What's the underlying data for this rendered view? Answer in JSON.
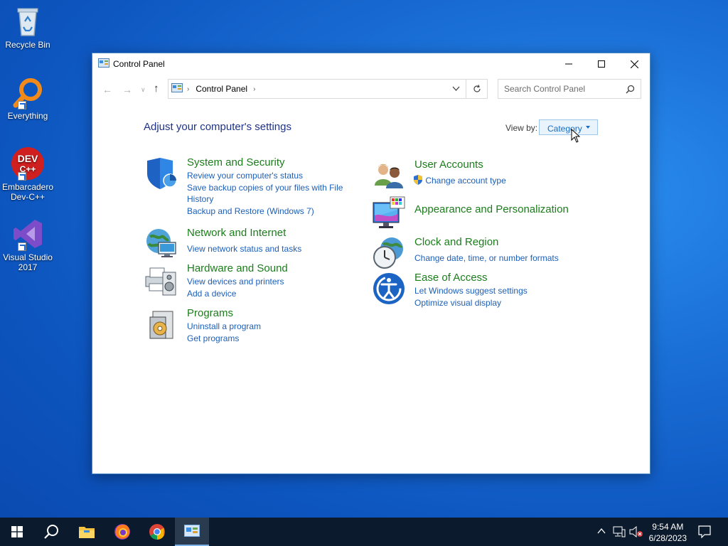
{
  "desktop": {
    "icons": [
      {
        "label": "Recycle Bin"
      },
      {
        "label": "Everything"
      },
      {
        "label": "Embarcadero Dev-C++",
        "badge": "DEV C++"
      },
      {
        "label": "Visual Studio 2017"
      }
    ]
  },
  "window": {
    "title": "Control Panel",
    "breadcrumb": "Control Panel",
    "search_placeholder": "Search Control Panel",
    "heading": "Adjust your computer's settings",
    "view_by_label": "View by:",
    "view_by_value": "Category"
  },
  "categories": {
    "system": {
      "title": "System and Security",
      "links": [
        "Review your computer's status",
        "Save backup copies of your files with File",
        "History",
        "Backup and Restore (Windows 7)"
      ]
    },
    "network": {
      "title": "Network and Internet",
      "links": [
        "View network status and tasks"
      ]
    },
    "hardware": {
      "title": "Hardware and Sound",
      "links": [
        "View devices and printers",
        "Add a device"
      ]
    },
    "programs": {
      "title": "Programs",
      "links": [
        "Uninstall a program",
        "Get programs"
      ]
    },
    "users": {
      "title": "User Accounts",
      "links": [
        "Change account type"
      ]
    },
    "appearance": {
      "title": "Appearance and Personalization",
      "links": []
    },
    "clock": {
      "title": "Clock and Region",
      "links": [
        "Change date, time, or number formats"
      ]
    },
    "ease": {
      "title": "Ease of Access",
      "links": [
        "Let Windows suggest settings",
        "Optimize visual display"
      ]
    }
  },
  "taskbar": {
    "time": "9:54 AM",
    "date": "6/28/2023",
    "apps": [
      "start-icon",
      "search-icon",
      "file-explorer-icon",
      "firefox-icon",
      "chrome-icon",
      "control-panel-icon"
    ]
  },
  "colors": {
    "category_title": "#1b7d1b",
    "link": "#1c5fb8",
    "heading": "#1e3287",
    "taskbar": "#0b1a2c"
  }
}
